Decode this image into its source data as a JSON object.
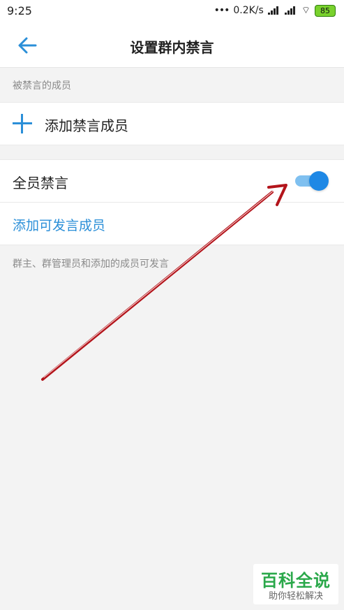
{
  "status_bar": {
    "time": "9:25",
    "network_speed": "0.2K/s",
    "battery": "85"
  },
  "header": {
    "title": "设置群内禁言"
  },
  "sections": {
    "muted_members_label": "被禁言的成员",
    "add_muted_member": "添加禁言成员",
    "mute_all": "全员禁言",
    "mute_all_enabled": true,
    "add_allowed_speaker": "添加可发言成员",
    "note": "群主、群管理员和添加的成员可发言"
  },
  "watermark": {
    "top": "百科全说",
    "bottom": "助你轻松解决"
  },
  "icons": {
    "back": "back-arrow-icon",
    "add": "plus-icon"
  },
  "colors": {
    "accent": "#2b8fd8",
    "toggle_track": "#7fc0f0",
    "toggle_knob": "#1e88e5",
    "watermark_green": "#2aa84a",
    "annotation_red": "#b3141b"
  }
}
